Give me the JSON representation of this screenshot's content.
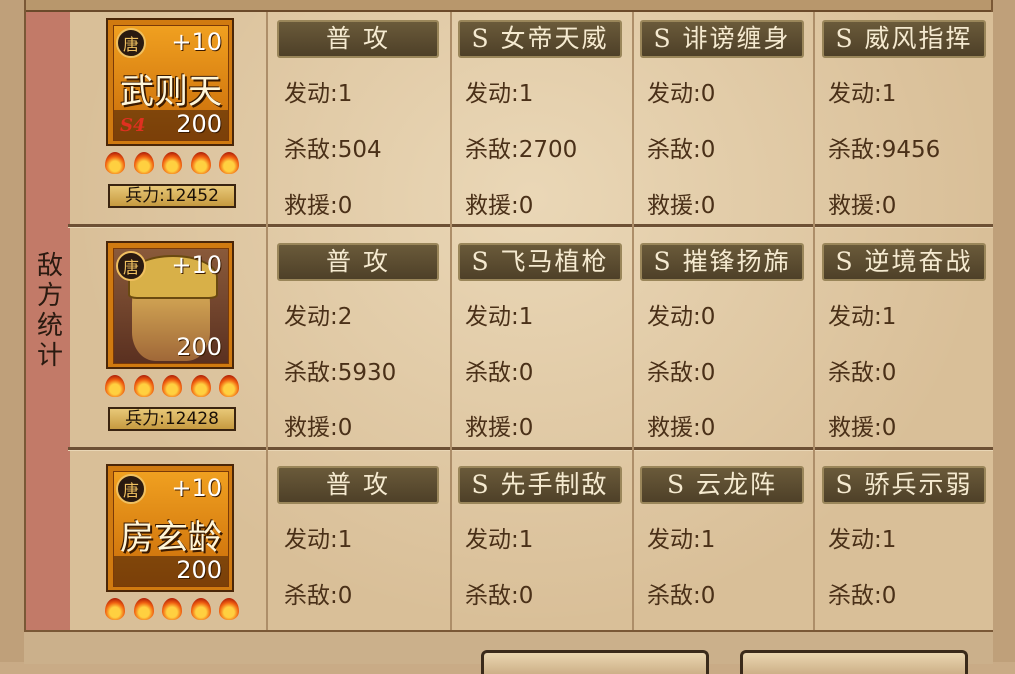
{
  "side_tab": {
    "label": "敌方统计"
  },
  "heroes": [
    {
      "name": "武则天",
      "faction_badge": "唐",
      "star_level": "+10",
      "level": "200",
      "season_mark": "S4",
      "troops": "兵力:12452",
      "flames": 5,
      "skills": [
        {
          "name": "普 攻",
          "trigger": "发动:1",
          "kills": "杀敌:504",
          "rescue": "救援:0"
        },
        {
          "name": "S 女帝天威",
          "trigger": "发动:1",
          "kills": "杀敌:2700",
          "rescue": "救援:0"
        },
        {
          "name": "S 诽谤缠身",
          "trigger": "发动:0",
          "kills": "杀敌:0",
          "rescue": "救援:0"
        },
        {
          "name": "S 威风指挥",
          "trigger": "发动:1",
          "kills": "杀敌:9456",
          "rescue": "救援:0"
        }
      ]
    },
    {
      "name": "",
      "faction_badge": "唐",
      "star_level": "+10",
      "level": "200",
      "season_mark": "",
      "troops": "兵力:12428",
      "flames": 5,
      "skills": [
        {
          "name": "普 攻",
          "trigger": "发动:2",
          "kills": "杀敌:5930",
          "rescue": "救援:0"
        },
        {
          "name": "S 飞马植枪",
          "trigger": "发动:1",
          "kills": "杀敌:0",
          "rescue": "救援:0"
        },
        {
          "name": "S 摧锋扬旆",
          "trigger": "发动:0",
          "kills": "杀敌:0",
          "rescue": "救援:0"
        },
        {
          "name": "S 逆境奋战",
          "trigger": "发动:1",
          "kills": "杀敌:0",
          "rescue": "救援:0"
        }
      ]
    },
    {
      "name": "房玄龄",
      "faction_badge": "唐",
      "star_level": "+10",
      "level": "200",
      "season_mark": "",
      "troops": "",
      "flames": 5,
      "skills": [
        {
          "name": "普 攻",
          "trigger": "发动:1",
          "kills": "杀敌:0",
          "rescue": ""
        },
        {
          "name": "S 先手制敌",
          "trigger": "发动:1",
          "kills": "杀敌:0",
          "rescue": ""
        },
        {
          "name": "S 云龙阵",
          "trigger": "发动:1",
          "kills": "杀敌:0",
          "rescue": ""
        },
        {
          "name": "S 骄兵示弱",
          "trigger": "发动:1",
          "kills": "杀敌:0",
          "rescue": ""
        }
      ]
    }
  ],
  "colors": {
    "accent_orange": "#d07a10",
    "side_tab": "#c27a68",
    "header_bg": "#5a4a30"
  },
  "icons": {
    "faction": "tang-seal-icon",
    "flame": "flame-icon",
    "portrait": "hero-portrait-icon"
  }
}
